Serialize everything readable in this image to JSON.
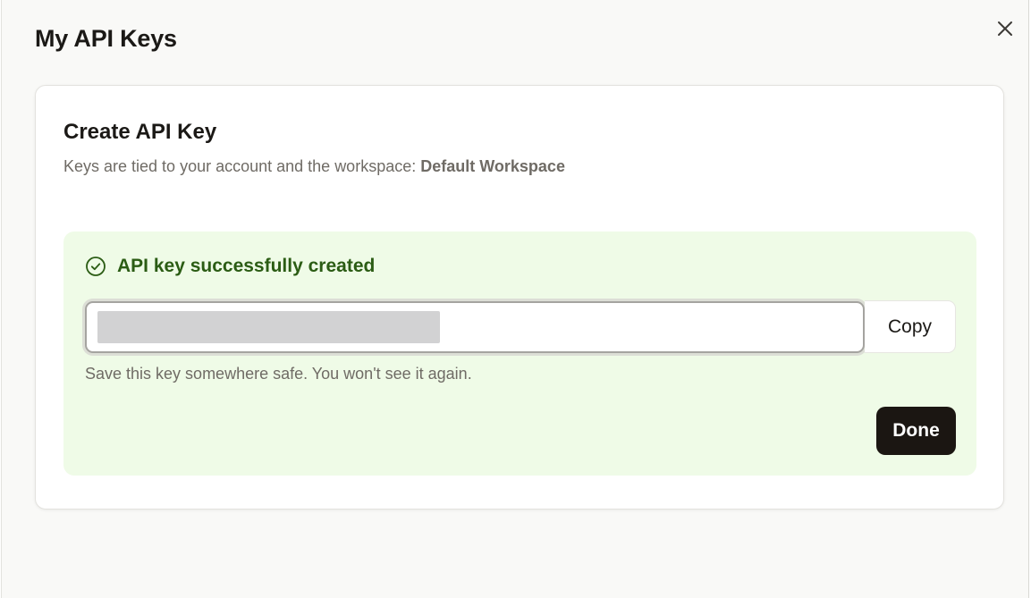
{
  "modal": {
    "title": "My API Keys",
    "close_icon": "close-icon"
  },
  "card": {
    "title": "Create API Key",
    "subtitle_prefix": "Keys are tied to your account and the workspace: ",
    "workspace_name": "Default Workspace"
  },
  "success": {
    "icon": "check-circle-icon",
    "message": "API key successfully created",
    "key_value": "",
    "copy_label": "Copy",
    "help_text": "Save this key somewhere safe. You won't see it again.",
    "done_label": "Done"
  },
  "colors": {
    "success_bg": "#effbe7",
    "success_text": "#2b5c14",
    "primary_button": "#1b1612"
  }
}
